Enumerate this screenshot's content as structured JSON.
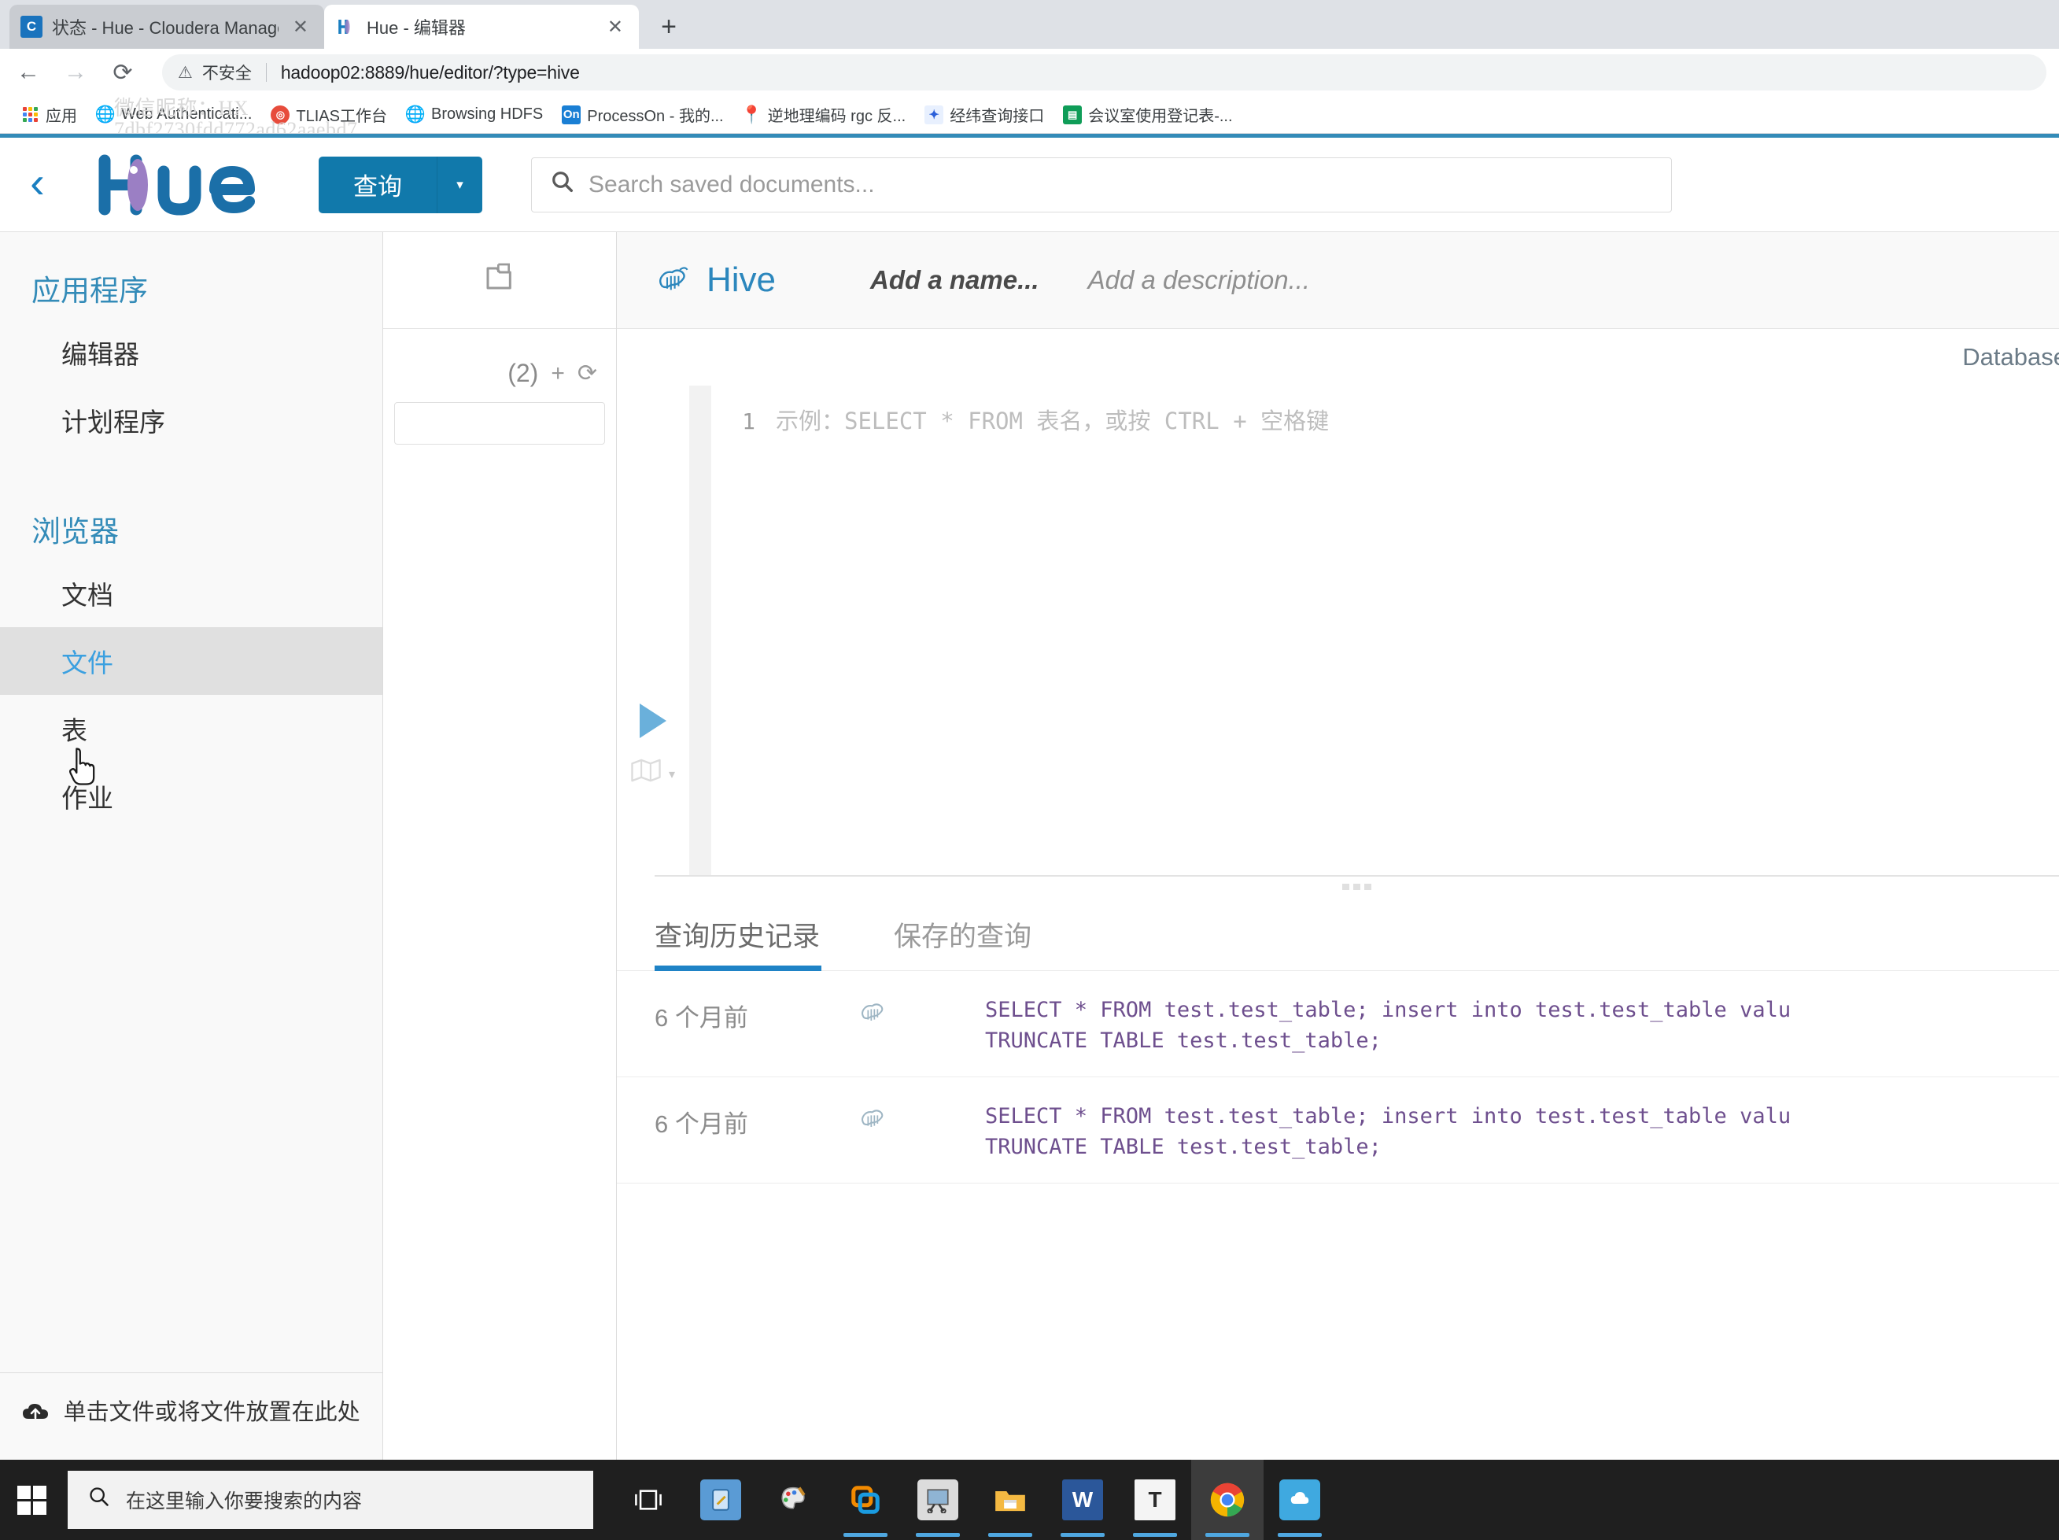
{
  "browser": {
    "tabs": [
      {
        "title": "状态 - Hue - Cloudera Manage",
        "favicon_text": "C",
        "favicon_kind": "cloudera",
        "active": false
      },
      {
        "title": "Hue - 编辑器",
        "favicon_text": "H",
        "favicon_kind": "hue",
        "active": true
      }
    ],
    "new_tab_label": "+",
    "close_label": "✕",
    "nav": {
      "back": "←",
      "forward": "→",
      "reload": "⟳"
    },
    "omnibox": {
      "security_icon": "warning-triangle-icon",
      "security_label": "不安全",
      "url": "hadoop02:8889/hue/editor/?type=hive"
    },
    "bookmarks": [
      {
        "label": "应用",
        "icon": "apps-grid-icon"
      },
      {
        "label": "Web Authenticati...",
        "icon": "globe-icon"
      },
      {
        "label": "TLIAS工作台",
        "icon": "target-icon"
      },
      {
        "label": "Browsing HDFS",
        "icon": "globe-icon"
      },
      {
        "label": "ProcessOn - 我的...",
        "icon": "on-icon",
        "icon_text": "On"
      },
      {
        "label": "逆地理编码 rgc 反...",
        "icon": "map-pin-icon"
      },
      {
        "label": "经纬查询接口",
        "icon": "baidu-paw-icon"
      },
      {
        "label": "会议室使用登记表-...",
        "icon": "sheets-icon"
      }
    ],
    "watermark": "微信昵称：HX\n7dbf2730fdd772ad62aaebd7"
  },
  "hue": {
    "back_label": "‹",
    "logo_alt": "hue-logo",
    "query_button": {
      "label": "查询",
      "caret": "▾"
    },
    "search": {
      "placeholder": "Search saved documents...",
      "icon": "search-icon"
    },
    "sidebar": {
      "sections": [
        {
          "title": "应用程序",
          "items": [
            {
              "label": "编辑器",
              "active": false
            },
            {
              "label": "计划程序",
              "active": false
            }
          ]
        },
        {
          "title": "浏览器",
          "items": [
            {
              "label": "文档",
              "active": false
            },
            {
              "label": "文件",
              "active": true
            },
            {
              "label": "表",
              "active": false
            },
            {
              "label": "作业",
              "active": false
            }
          ]
        }
      ],
      "upload": {
        "icon": "cloud-upload-icon",
        "label": "单击文件或将文件放置在此处"
      }
    },
    "assist": {
      "doc_icon": "documents-icon",
      "count": "(2)",
      "add_icon": "+",
      "refresh_icon": "⟳",
      "search_value": ""
    },
    "editor": {
      "engine_name": "Hive",
      "engine_icon": "hive-bee-icon",
      "name_placeholder": "Add a name...",
      "description_placeholder": "Add a description...",
      "database_label": "Database",
      "run_icon": "play-icon",
      "map_icon": "map-icon",
      "map_caret": "▾",
      "line_number": "1",
      "code_placeholder": "示例：SELECT * FROM 表名，或按 CTRL + 空格键"
    },
    "history": {
      "tabs": [
        {
          "label": "查询历史记录",
          "active": true
        },
        {
          "label": "保存的查询",
          "active": false
        }
      ],
      "rows": [
        {
          "time": "6 个月前",
          "icon": "hive-bee-icon",
          "sql_line1": "SELECT * FROM test.test_table; insert into test.test_table valu",
          "sql_line2": "TRUNCATE TABLE test.test_table;"
        },
        {
          "time": "6 个月前",
          "icon": "hive-bee-icon",
          "sql_line1": "SELECT * FROM test.test_table; insert into test.test_table valu",
          "sql_line2": "TRUNCATE TABLE test.test_table;"
        }
      ]
    }
  },
  "taskbar": {
    "start_label": "start-button",
    "search_placeholder": "在这里输入你要搜索的内容",
    "search_icon": "search-icon",
    "apps": [
      {
        "name": "task-view-icon",
        "label": "",
        "color": "#1f1f1f",
        "active": false,
        "running": false
      },
      {
        "name": "remote-tool-icon",
        "label": "",
        "color": "#3f7fb5",
        "active": false,
        "running": false
      },
      {
        "name": "paint-icon",
        "label": "",
        "color": "#e8e8e8",
        "active": false,
        "running": false
      },
      {
        "name": "vmware-icon",
        "label": "",
        "color": "#f28a00",
        "active": false,
        "running": true
      },
      {
        "name": "snipping-tool-icon",
        "label": "",
        "color": "#cfcfcf",
        "active": false,
        "running": true
      },
      {
        "name": "file-explorer-icon",
        "label": "",
        "color": "#f6b93b",
        "active": false,
        "running": true
      },
      {
        "name": "word-icon",
        "label": "W",
        "color": "#2b579a",
        "active": false,
        "running": true
      },
      {
        "name": "typora-icon",
        "label": "T",
        "color": "#f2f2f2",
        "active": false,
        "running": true
      },
      {
        "name": "chrome-icon",
        "label": "",
        "color": "#4285f4",
        "active": true,
        "running": true
      },
      {
        "name": "cloud-app-icon",
        "label": "",
        "color": "#3fa9e0",
        "active": false,
        "running": true
      }
    ]
  },
  "colors": {
    "hue_blue": "#1179ab",
    "accent_blue": "#338bb8",
    "tab_underline": "#1f83c6",
    "sql_keyword": "#9a6fbf"
  }
}
